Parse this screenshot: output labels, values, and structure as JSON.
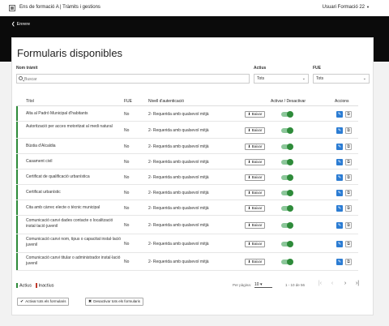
{
  "header": {
    "app_title": "Ens de formació A | Tràmits i gestions",
    "user": "Usuari Formació 22"
  },
  "nav": {
    "back_label": "Enrere"
  },
  "page": {
    "title": "Formularis disponibles"
  },
  "filters": {
    "search_label": "Nom tràmit",
    "search_placeholder": "Buscar",
    "actius_label": "Actius",
    "actius_value": "Tots",
    "fue_label": "FUE",
    "fue_value": "Tots"
  },
  "table": {
    "columns": {
      "title": "Títol",
      "fue": "FUE",
      "nivell": "Nivell d'autenticació",
      "activar": "Activar / Desactivar",
      "accions": "Accions"
    },
    "save_label": "Baixar",
    "rows": [
      {
        "title": "Alta al Padró Municipal d'habitants",
        "fue": "No",
        "nivell": "2- Requerida amb qualsevol mitjà",
        "active": true
      },
      {
        "title": "Autorització per acces motoritzat al medi natural",
        "fue": "No",
        "nivell": "2- Requerida amb qualsevol mitjà",
        "active": true
      },
      {
        "title": "Bústia d'Alcaldia",
        "fue": "No",
        "nivell": "2- Requerida amb qualsevol mitjà",
        "active": true
      },
      {
        "title": "Casament civil",
        "fue": "No",
        "nivell": "2- Requerida amb qualsevol mitjà",
        "active": true
      },
      {
        "title": "Certificat de qualificació urbanística",
        "fue": "No",
        "nivell": "2- Requerida amb qualsevol mitjà",
        "active": true
      },
      {
        "title": "Certificat urbanístic",
        "fue": "No",
        "nivell": "2- Requerida amb qualsevol mitjà",
        "active": true
      },
      {
        "title": "Cita amb càrrec electe o tècnic municipal",
        "fue": "No",
        "nivell": "2- Requerida amb qualsevol mitjà",
        "active": true
      },
      {
        "title": "Comunicació canvi dades contacte o localització instal·lació juvenil",
        "fue": "No",
        "nivell": "2- Requerida amb qualsevol mitjà",
        "active": true
      },
      {
        "title": "Comunicació canvi nom, tipus o capacitat instal·lació juvenil",
        "fue": "No",
        "nivell": "2- Requerida amb qualsevol mitjà",
        "active": true
      },
      {
        "title": "Comunicació canvi titular o administrador instal·lació juvenil",
        "fue": "No",
        "nivell": "2- Requerida amb qualsevol mitjà",
        "active": true
      }
    ]
  },
  "legend": {
    "active": "Actius",
    "inactive": "Inactius"
  },
  "pagination": {
    "per_page_label": "Per pàgina:",
    "per_page_value": "10",
    "range": "1 - 10 de 56"
  },
  "footer": {
    "activate_all": "Activar tots els formularis",
    "deactivate_all": "Desactivar tots els formularis"
  },
  "colors": {
    "accent_green": "#2e8b3a",
    "accent_blue": "#2b7cd3",
    "inactive_red": "#c0392b"
  }
}
